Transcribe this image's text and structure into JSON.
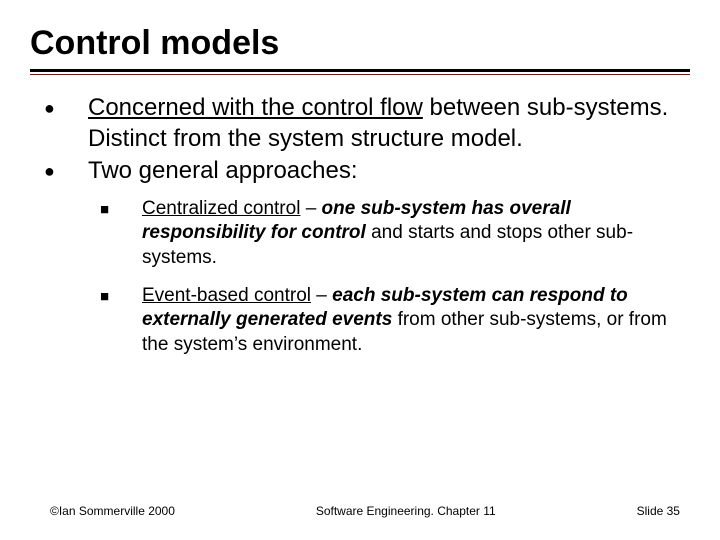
{
  "title": "Control models",
  "b1_u": "Concerned with the control flow",
  "b1_rest": " between sub-systems.  Distinct from the system structure model.",
  "b2": "Two general approaches:",
  "s1_u": "Centralized control",
  "s1_dash": " – ",
  "s1_bi": "one sub-system has overall responsibility for control",
  "s1_rest": " and starts and stops other sub-systems.",
  "s2_u": "Event-based control",
  "s2_dash": " – ",
  "s2_bi": "each sub-system can respond to externally generated events",
  "s2_rest": " from other sub-systems, or from the system’s environment.",
  "footer_left": "©Ian Sommerville 2000",
  "footer_center": "Software Engineering. Chapter 11",
  "footer_right": "Slide 35"
}
